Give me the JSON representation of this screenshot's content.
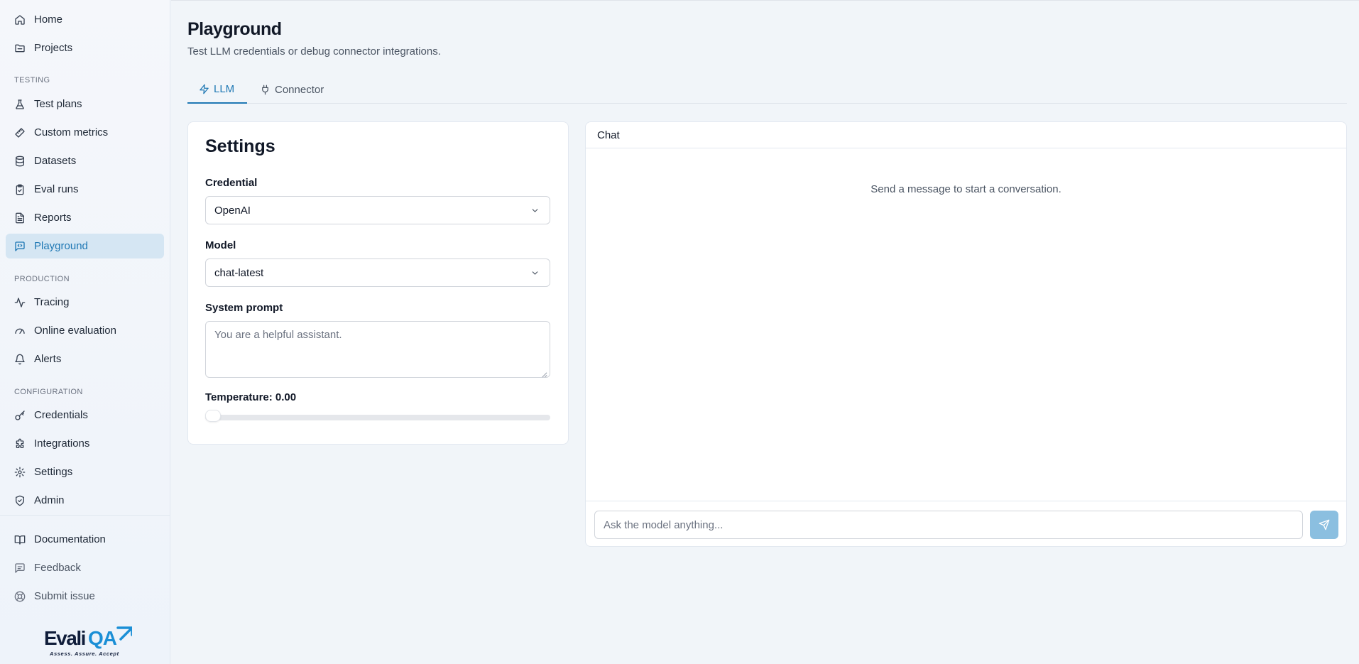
{
  "sidebar": {
    "nav_top": [
      {
        "label": "Home",
        "icon": "home-icon"
      },
      {
        "label": "Projects",
        "icon": "folder-icon"
      }
    ],
    "testing_label": "TESTING",
    "testing": [
      {
        "label": "Test plans",
        "icon": "flask-icon"
      },
      {
        "label": "Custom metrics",
        "icon": "ruler-icon"
      },
      {
        "label": "Datasets",
        "icon": "database-icon"
      },
      {
        "label": "Eval runs",
        "icon": "clipboard-icon"
      },
      {
        "label": "Reports",
        "icon": "file-text-icon"
      },
      {
        "label": "Playground",
        "icon": "message-code-icon",
        "active": true
      }
    ],
    "production_label": "PRODUCTION",
    "production": [
      {
        "label": "Tracing",
        "icon": "activity-icon"
      },
      {
        "label": "Online evaluation",
        "icon": "gauge-icon"
      },
      {
        "label": "Alerts",
        "icon": "bell-icon"
      }
    ],
    "configuration_label": "CONFIGURATION",
    "configuration": [
      {
        "label": "Credentials",
        "icon": "key-icon"
      },
      {
        "label": "Integrations",
        "icon": "puzzle-icon"
      },
      {
        "label": "Settings",
        "icon": "gear-icon"
      },
      {
        "label": "Admin",
        "icon": "shield-check-icon"
      }
    ],
    "footer": [
      {
        "label": "Documentation",
        "icon": "book-icon"
      },
      {
        "label": "Feedback",
        "icon": "message-square-icon"
      },
      {
        "label": "Submit issue",
        "icon": "life-buoy-icon"
      }
    ],
    "logo": {
      "brand_text": "EvaliQA",
      "tagline": "Assess. Assure. Accept"
    }
  },
  "header": {
    "title": "Playground",
    "subtitle": "Test LLM credentials or debug connector integrations."
  },
  "tabs": [
    {
      "label": "LLM",
      "icon": "zap-icon",
      "active": true
    },
    {
      "label": "Connector",
      "icon": "plug-icon",
      "active": false
    }
  ],
  "settings": {
    "title": "Settings",
    "credential_label": "Credential",
    "credential_value": "OpenAI",
    "model_label": "Model",
    "model_value": "chat-latest",
    "system_prompt_label": "System prompt",
    "system_prompt_placeholder": "You are a helpful assistant.",
    "temperature_label": "Temperature: 0.00",
    "temperature_value": 0.0
  },
  "chat": {
    "title": "Chat",
    "empty_message": "Send a message to start a conversation.",
    "input_placeholder": "Ask the model anything..."
  },
  "colors": {
    "accent": "#1f78b4",
    "active_nav_bg": "#d5e6f3",
    "send_button_bg": "#8bbfe0",
    "logo_dark": "#101d3a",
    "logo_accent": "#1b8fd6"
  }
}
